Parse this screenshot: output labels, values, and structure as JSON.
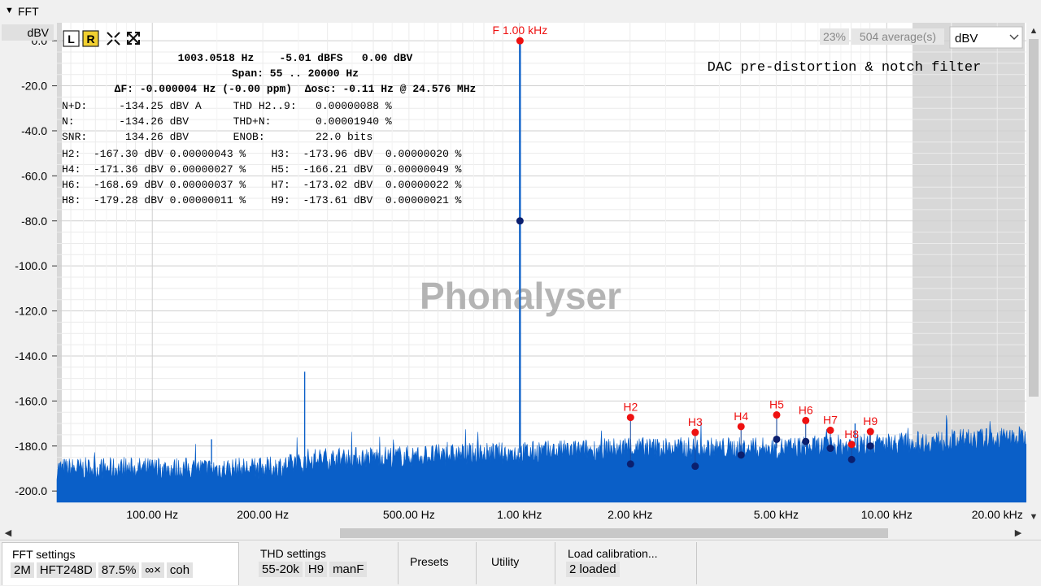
{
  "window": {
    "title": "FFT"
  },
  "unit_label": "dBV",
  "overlay": {
    "line1": "1003.0518 Hz    -5.01 dBFS   0.00 dBV",
    "line2": "Span: 55 .. 20000 Hz",
    "line3": "ΔF: -0.000004 Hz (-0.00 ppm)  Δosc: -0.11 Hz @ 24.576 MHz",
    "stats": [
      "N+D:     -134.25 dBV A     THD H2..9:   0.00000088 %",
      "N:       -134.26 dBV       THD+N:       0.00001940 %",
      "SNR:      134.26 dBV       ENOB:        22.0 bits",
      "H2:  -167.30 dBV 0.00000043 %    H3:  -173.96 dBV  0.00000020 %",
      "H4:  -171.36 dBV 0.00000027 %    H5:  -166.21 dBV  0.00000049 %",
      "H6:  -168.69 dBV 0.00000037 %    H7:  -173.02 dBV  0.00000022 %",
      "H8:  -179.28 dBV 0.00000011 %    H9:  -173.61 dBV  0.00000021 %"
    ]
  },
  "annotation": "DAC pre-distortion & notch filter",
  "watermark": "Phonalyser",
  "controls": {
    "zoom_pct": "23%",
    "averages": "504 average(s)",
    "unit_select": "dBV",
    "btn_left": "L",
    "btn_right": "R"
  },
  "colors": {
    "spectrum": "#0a5fc8",
    "marker_red": "#ee1111",
    "marker_navy": "#0b1f6e",
    "plot_bg": "#ffffff",
    "shade": "#d8d8d8"
  },
  "chart_data": {
    "type": "line",
    "x_scale": "log",
    "xlim": [
      55,
      24000
    ],
    "ylim": [
      -205,
      8
    ],
    "yticks": [
      0,
      -20,
      -40,
      -60,
      -80,
      -100,
      -120,
      -140,
      -160,
      -180,
      -200
    ],
    "ytick_labels": [
      "0.0",
      "-20.0",
      "-40.0",
      "-60.0",
      "-80.0",
      "-100.0",
      "-120.0",
      "-140.0",
      "-160.0",
      "-180.0",
      "-200.0"
    ],
    "xticks": [
      100,
      200,
      500,
      1000,
      2000,
      5000,
      10000,
      20000
    ],
    "xtick_labels": [
      "100.00 Hz",
      "200.00 Hz",
      "500.00 Hz",
      "1.00 kHz",
      "2.00 kHz",
      "5.00 kHz",
      "10.00 kHz",
      "20.00 kHz"
    ],
    "grid": true,
    "span_hz": [
      55,
      20000
    ],
    "noise_floor_db": [
      [
        55,
        -188
      ],
      [
        200,
        -188
      ],
      [
        250,
        -186
      ],
      [
        1000,
        -183
      ],
      [
        2000,
        -181
      ],
      [
        5000,
        -181
      ],
      [
        10000,
        -179
      ],
      [
        24000,
        -176
      ]
    ],
    "spurs": [
      [
        1003,
        -1
      ],
      [
        260,
        -147
      ],
      [
        145,
        -177
      ],
      [
        8200,
        -170
      ],
      [
        22000,
        -175
      ]
    ],
    "fundamental": {
      "label": "F 1.00 kHz",
      "freq": 1003.0518,
      "level": 0.0,
      "lower_marker": -80.0
    },
    "harmonics": [
      {
        "label": "H2",
        "freq": 2006,
        "level": -167.3,
        "lower": -188.0
      },
      {
        "label": "H3",
        "freq": 3009,
        "level": -173.96,
        "lower": -189.0
      },
      {
        "label": "H4",
        "freq": 4012,
        "level": -171.36,
        "lower": -184.0
      },
      {
        "label": "H5",
        "freq": 5015,
        "level": -166.21,
        "lower": -177.0
      },
      {
        "label": "H6",
        "freq": 6018,
        "level": -168.69,
        "lower": -178.0
      },
      {
        "label": "H7",
        "freq": 7021,
        "level": -173.02,
        "lower": -181.0
      },
      {
        "label": "H8",
        "freq": 8024,
        "level": -179.28,
        "lower": -186.0
      },
      {
        "label": "H9",
        "freq": 9027,
        "level": -173.61,
        "lower": -180.0
      }
    ]
  },
  "tabs": [
    {
      "title": "FFT settings",
      "chips": [
        "2M",
        "HFT248D",
        "87.5%",
        "∞×",
        "coh"
      ]
    },
    {
      "title": "THD settings",
      "chips": [
        "55-20k",
        "H9",
        "manF"
      ]
    },
    {
      "title": "Presets",
      "chips": []
    },
    {
      "title": "Utility",
      "chips": []
    },
    {
      "title": "Load calibration...",
      "chips": [
        "2 loaded"
      ]
    }
  ]
}
